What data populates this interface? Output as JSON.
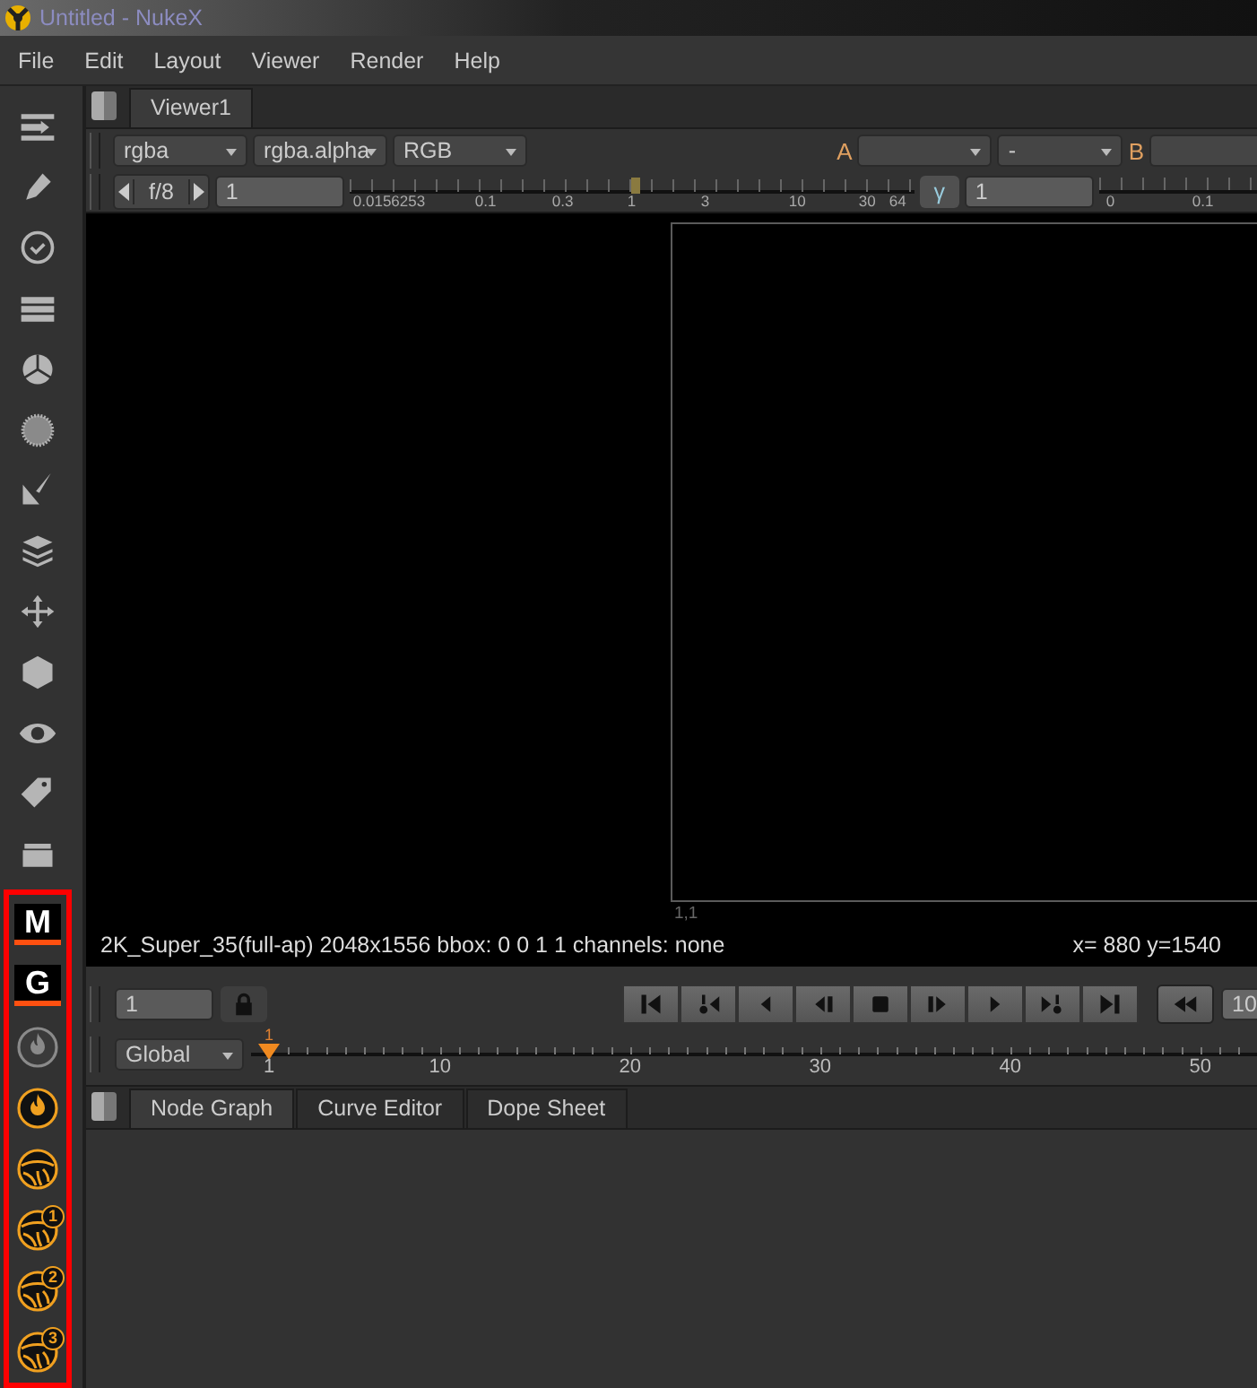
{
  "window": {
    "title": "Untitled - NukeX"
  },
  "menu": [
    "File",
    "Edit",
    "Layout",
    "Viewer",
    "Render",
    "Help"
  ],
  "toolbar": [
    {
      "kind": "image"
    },
    {
      "kind": "draw"
    },
    {
      "kind": "time"
    },
    {
      "kind": "channel"
    },
    {
      "kind": "color"
    },
    {
      "kind": "filter"
    },
    {
      "kind": "keyer"
    },
    {
      "kind": "merge"
    },
    {
      "kind": "transform"
    },
    {
      "kind": "object"
    },
    {
      "kind": "views"
    },
    {
      "kind": "metadata"
    },
    {
      "kind": "toolsets"
    }
  ],
  "highlighted_tools": {
    "items": [
      {
        "kind": "letter",
        "label": "M",
        "disabled": false
      },
      {
        "kind": "letter",
        "label": "G",
        "disabled": false
      },
      {
        "kind": "flame",
        "disabled": true
      },
      {
        "kind": "flame",
        "disabled": false
      },
      {
        "kind": "sphere",
        "disabled": false
      },
      {
        "kind": "sphere",
        "badge": "1",
        "disabled": false
      },
      {
        "kind": "sphere",
        "badge": "2",
        "disabled": false
      },
      {
        "kind": "sphere",
        "badge": "3",
        "disabled": false
      }
    ]
  },
  "viewer_tabs": [
    {
      "label": "Viewer1",
      "selected": true
    }
  ],
  "channels": [
    "rgba",
    "rgba.alpha",
    "RGB"
  ],
  "compare": {
    "a_label": "A",
    "operation": "-",
    "b_label": "B"
  },
  "gain": {
    "fstop": "f/8",
    "value": "1",
    "level": 0.5,
    "scale": [
      "0.0156253",
      "0.1",
      "0.3",
      "1",
      "3",
      "10",
      "30",
      "64"
    ]
  },
  "gamma": {
    "label": "γ",
    "value": "1",
    "scale": [
      "0",
      "0.1"
    ]
  },
  "viewer": {
    "corner_label": "1,1",
    "format": "2K_Super_35(full-ap) 2048x1556 bbox: 0 0 1 1 channels: none",
    "coords": "x= 880 y=1540"
  },
  "playback": {
    "frame": "1",
    "buttons": [
      {
        "kind": "first"
      },
      {
        "kind": "prev-key"
      },
      {
        "kind": "play-back"
      },
      {
        "kind": "prev-frame"
      },
      {
        "kind": "stop"
      },
      {
        "kind": "next-frame"
      },
      {
        "kind": "play"
      },
      {
        "kind": "next-key"
      },
      {
        "kind": "last"
      }
    ],
    "increment": "10"
  },
  "timeline": {
    "range": "Global",
    "current": "1",
    "ticks": [
      "1",
      "10",
      "20",
      "30",
      "40",
      "50"
    ]
  },
  "panel_tabs": [
    {
      "label": "Node Graph",
      "selected": true
    },
    {
      "label": "Curve Editor",
      "selected": false
    },
    {
      "label": "Dope Sheet",
      "selected": false
    }
  ]
}
